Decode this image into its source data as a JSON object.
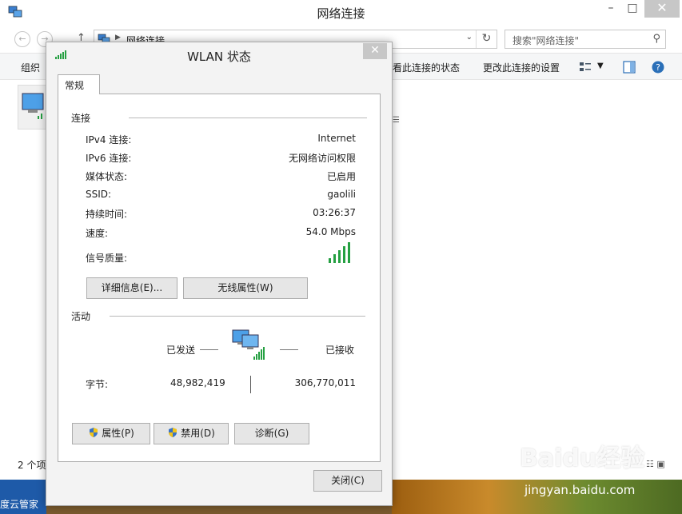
{
  "explorer": {
    "title": "网络连接",
    "address": "网络连接",
    "search_placeholder": "搜索\"网络连接\"",
    "toolbar": {
      "organize": "组织",
      "view_status": "看此连接的状态",
      "change_settings": "更改此连接的设置"
    },
    "status_text": "2 个项"
  },
  "taskbar": {
    "desktop_label": "度云管家"
  },
  "watermark": {
    "logo_text": "Baidu经验",
    "url": "jingyan.baidu.com"
  },
  "dialog": {
    "title": "WLAN 状态",
    "tab": "常规",
    "connection_section": "连接",
    "rows": [
      {
        "label": "IPv4 连接:",
        "value": "Internet"
      },
      {
        "label": "IPv6 连接:",
        "value": "无网络访问权限"
      },
      {
        "label": "媒体状态:",
        "value": "已启用"
      },
      {
        "label": "SSID:",
        "value": "gaolili"
      },
      {
        "label": "持续时间:",
        "value": "03:26:37"
      },
      {
        "label": "速度:",
        "value": "54.0 Mbps"
      }
    ],
    "signal_label": "信号质量:",
    "signal_level": 5,
    "details_button": "详细信息(E)...",
    "wireless_props_button": "无线属性(W)",
    "activity_section": "活动",
    "sent_label": "已发送",
    "received_label": "已接收",
    "bytes_label": "字节:",
    "bytes_sent": "48,982,419",
    "bytes_received": "306,770,011",
    "properties_button": "属性(P)",
    "disable_button": "禁用(D)",
    "diagnose_button": "诊断(G)",
    "close_button": "关闭(C)"
  },
  "colors": {
    "signal_green": "#25a042",
    "close_gray": "#c7c7c7",
    "accent_blue": "#1e5aa8"
  }
}
